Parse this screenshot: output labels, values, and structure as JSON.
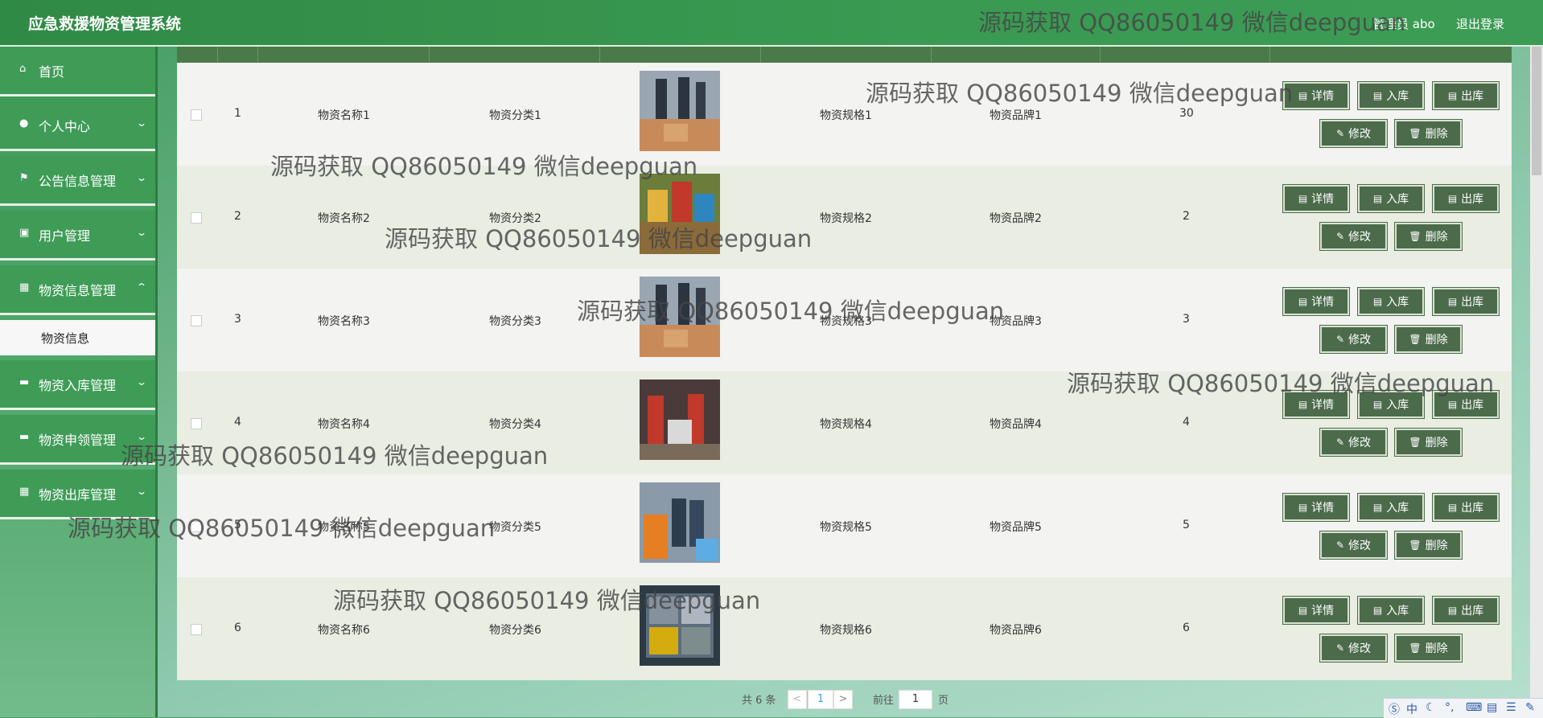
{
  "app": {
    "title": "应急救援物资管理系统",
    "user": "管理员 abo",
    "logout": "退出登录"
  },
  "sidebar": {
    "items": [
      {
        "label": "首页",
        "icon": "home-icon"
      },
      {
        "label": "个人中心",
        "icon": "user-icon"
      },
      {
        "label": "公告信息管理",
        "icon": "flag-icon"
      },
      {
        "label": "用户管理",
        "icon": "id-card-icon"
      },
      {
        "label": "物资信息管理",
        "icon": "grid-icon"
      },
      {
        "label": "物资入库管理",
        "icon": "chat-icon"
      },
      {
        "label": "物资申领管理",
        "icon": "chat-icon"
      },
      {
        "label": "物资出库管理",
        "icon": "grid-icon"
      }
    ],
    "active_sub": "物资信息"
  },
  "table": {
    "rows": [
      {
        "no": "1",
        "name": "物资名称1",
        "category": "物资分类1",
        "spec": "物资规格1",
        "brand": "物资品牌1",
        "qty": "30"
      },
      {
        "no": "2",
        "name": "物资名称2",
        "category": "物资分类2",
        "spec": "物资规格2",
        "brand": "物资品牌2",
        "qty": "2"
      },
      {
        "no": "3",
        "name": "物资名称3",
        "category": "物资分类3",
        "spec": "物资规格3",
        "brand": "物资品牌3",
        "qty": "3"
      },
      {
        "no": "4",
        "name": "物资名称4",
        "category": "物资分类4",
        "spec": "物资规格4",
        "brand": "物资品牌4",
        "qty": "4"
      },
      {
        "no": "5",
        "name": "物资名称5",
        "category": "物资分类5",
        "spec": "物资规格5",
        "brand": "物资品牌5",
        "qty": "5"
      },
      {
        "no": "6",
        "name": "物资名称6",
        "category": "物资分类6",
        "spec": "物资规格6",
        "brand": "物资品牌6",
        "qty": "6"
      }
    ],
    "buttons": {
      "detail": "详情",
      "stock_in": "入库",
      "stock_out": "出库",
      "edit": "修改",
      "delete": "删除"
    }
  },
  "pagination": {
    "total": "共 6 条",
    "current_page": "1",
    "goto_label": "前往",
    "goto_value": "1",
    "page_suffix": "页",
    "prev": "<",
    "next": ">"
  },
  "watermark": "源码获取 QQ86050149 微信deepguan",
  "ime": {
    "lang": "中"
  }
}
